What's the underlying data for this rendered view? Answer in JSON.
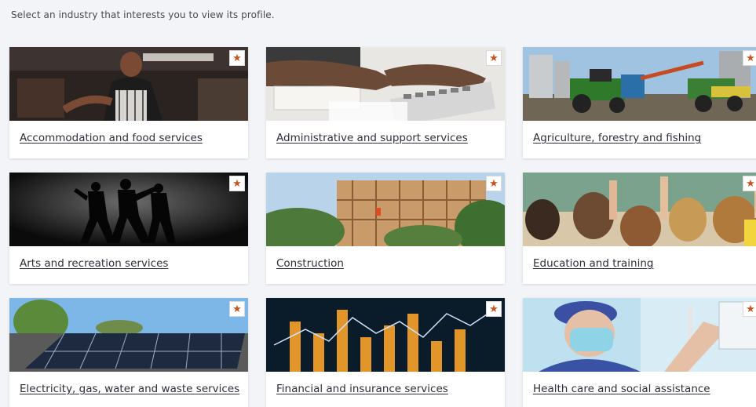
{
  "intro_text": "Select an industry that interests you to view its profile.",
  "favourite_glyph": "★",
  "accent_color": "#c8541e",
  "industries": [
    {
      "label": "Accommodation and food services"
    },
    {
      "label": "Administrative and support services"
    },
    {
      "label": "Agriculture, forestry and fishing"
    },
    {
      "label": "Arts and recreation services"
    },
    {
      "label": "Construction"
    },
    {
      "label": "Education and training"
    },
    {
      "label": "Electricity, gas, water and waste services"
    },
    {
      "label": "Financial and insurance services"
    },
    {
      "label": "Health care and social assistance"
    }
  ]
}
